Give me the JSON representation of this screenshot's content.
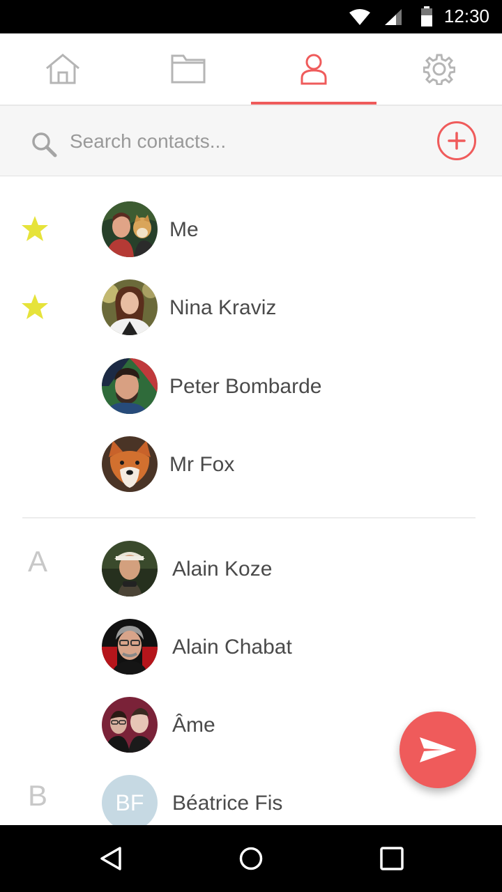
{
  "status_bar": {
    "time": "12:30"
  },
  "tabs": [
    {
      "name": "home",
      "icon": "home-icon",
      "active": false
    },
    {
      "name": "folder",
      "icon": "folder-icon",
      "active": false
    },
    {
      "name": "contacts",
      "icon": "person-icon",
      "active": true
    },
    {
      "name": "settings",
      "icon": "gear-icon",
      "active": false
    }
  ],
  "search": {
    "placeholder": "Search contacts..."
  },
  "favorites": [
    {
      "name": "Me",
      "starred": true
    },
    {
      "name": "Nina Kraviz",
      "starred": true
    },
    {
      "name": "Peter Bombarde",
      "starred": false
    },
    {
      "name": "Mr Fox",
      "starred": false
    }
  ],
  "contacts": [
    {
      "section": "A",
      "name": "Alain Koze"
    },
    {
      "section": "",
      "name": "Alain Chabat"
    },
    {
      "section": "",
      "name": "Âme"
    },
    {
      "section": "B",
      "name": "Béatrice Fis",
      "initials": "BF"
    }
  ],
  "colors": {
    "accent": "#ef5b5b",
    "star": "#e6e33a",
    "section_letter": "#c8c8c8",
    "initials_bg": "#c6d9e3"
  }
}
